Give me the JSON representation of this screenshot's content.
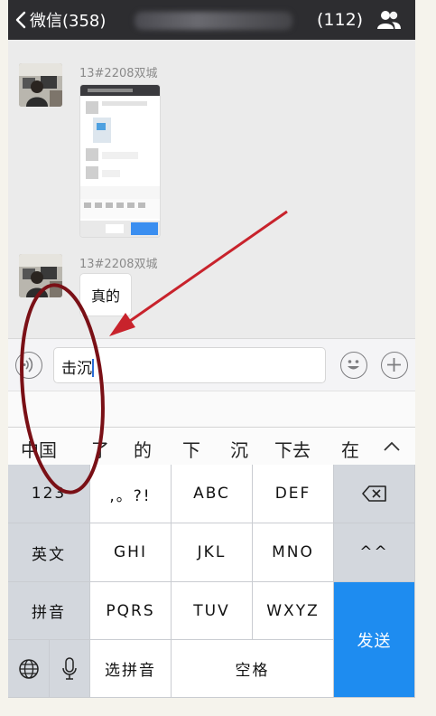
{
  "header": {
    "back_label": "微信(358)",
    "member_count": "(112)",
    "back_icon": "chevron-left-icon",
    "group_icon": "group-members-icon"
  },
  "chat": {
    "messages": [
      {
        "sender": "13#2208双城",
        "type": "image"
      },
      {
        "sender": "13#2208双城",
        "type": "text",
        "text": "真的"
      }
    ]
  },
  "input": {
    "value": "击沉",
    "voice_icon": "voice-icon",
    "emoji_icon": "emoji-icon",
    "plus_icon": "plus-icon"
  },
  "candidates": [
    "中国",
    "了",
    "的",
    "下",
    "沉",
    "下去",
    "在"
  ],
  "keyboard": {
    "row1": [
      "123",
      ",。?!",
      "ABC",
      "DEF"
    ],
    "row2": [
      "英文",
      "GHI",
      "JKL",
      "MNO",
      "^^"
    ],
    "row3": [
      "拼音",
      "PQRS",
      "TUV",
      "WXYZ"
    ],
    "row4": [
      "选拼音",
      "空格"
    ],
    "send": "发送"
  },
  "colors": {
    "header_bg": "#2d2d30",
    "send_blue": "#1e8cf0",
    "annotation_red": "#c8232c",
    "annotation_ring": "#7a1016"
  }
}
